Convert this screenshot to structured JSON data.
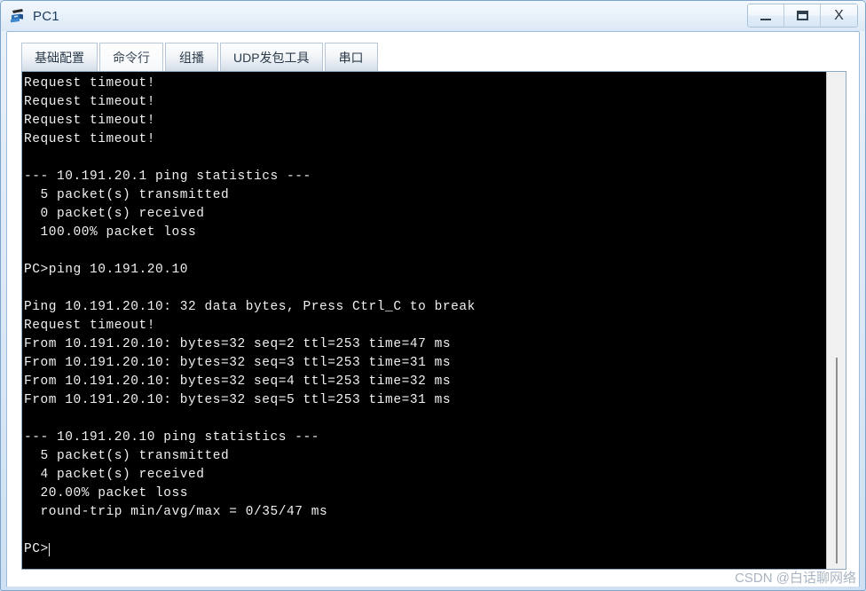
{
  "window": {
    "title": "PC1",
    "icon": "pc-computer-icon",
    "controls": {
      "minimize_label": "—",
      "maximize_label": "□",
      "close_label": "X"
    }
  },
  "tabs": [
    {
      "label": "基础配置",
      "name": "tab-basic-config",
      "selected": false
    },
    {
      "label": "命令行",
      "name": "tab-command-line",
      "selected": true
    },
    {
      "label": "组播",
      "name": "tab-multicast",
      "selected": false
    },
    {
      "label": "UDP发包工具",
      "name": "tab-udp-tool",
      "selected": false
    },
    {
      "label": "串口",
      "name": "tab-serial-port",
      "selected": false
    }
  ],
  "terminal": {
    "prompt": "PC>",
    "lines": [
      "Request timeout!",
      "Request timeout!",
      "Request timeout!",
      "Request timeout!",
      "",
      "--- 10.191.20.1 ping statistics ---",
      "  5 packet(s) transmitted",
      "  0 packet(s) received",
      "  100.00% packet loss",
      "",
      "PC>ping 10.191.20.10",
      "",
      "Ping 10.191.20.10: 32 data bytes, Press Ctrl_C to break",
      "Request timeout!",
      "From 10.191.20.10: bytes=32 seq=2 ttl=253 time=47 ms",
      "From 10.191.20.10: bytes=32 seq=3 ttl=253 time=31 ms",
      "From 10.191.20.10: bytes=32 seq=4 ttl=253 time=32 ms",
      "From 10.191.20.10: bytes=32 seq=5 ttl=253 time=31 ms",
      "",
      "--- 10.191.20.10 ping statistics ---",
      "  5 packet(s) transmitted",
      "  4 packet(s) received",
      "  20.00% packet loss",
      "  round-trip min/avg/max = 0/35/47 ms",
      "",
      "PC>"
    ],
    "background_color": "#000000",
    "text_color": "#f0f0f0"
  },
  "scrollbar": {
    "name": "terminal-vertical-scrollbar"
  },
  "watermark": {
    "text": "CSDN @白话聊网络"
  }
}
